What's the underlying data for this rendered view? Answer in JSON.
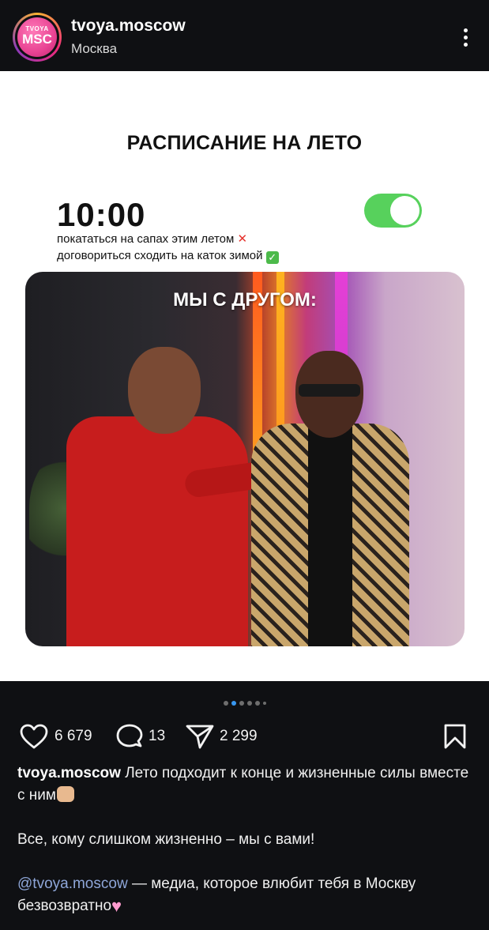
{
  "header": {
    "avatar_top": "TVOYA",
    "avatar_main": "MSC",
    "username": "tvoya.moscow",
    "location": "Москва",
    "more_icon": "more-vertical-icon"
  },
  "post": {
    "title": "РАСПИСАНИЕ НА ЛЕТО",
    "time": "10:00",
    "toggle_on": true,
    "toggle_color": "#57d15c",
    "line1": "покататься на сапах этим летом",
    "line1_mark": "✕",
    "line2": "договориться сходить на каток зимой",
    "line2_mark": "✓",
    "photo_caption": "МЫ С ДРУГОМ:"
  },
  "carousel": {
    "total": 6,
    "active_index": 1,
    "accent": "#3897f0"
  },
  "actions": {
    "likes": "6 679",
    "comments": "13",
    "shares": "2 299",
    "icons": [
      "heart-icon",
      "comment-icon",
      "share-icon",
      "bookmark-icon"
    ]
  },
  "caption": {
    "user": "tvoya.moscow",
    "text1": " Лето подходит к концe и жизненные силы вместе с ним",
    "paragraph2": "Все, кому слишком жизненно – мы с вами!",
    "mention": "@tvoya.moscow",
    "text3": " — медиа, которое влюбит тебя в Москву безвозвратно",
    "mention_color": "#8ea6d8"
  }
}
